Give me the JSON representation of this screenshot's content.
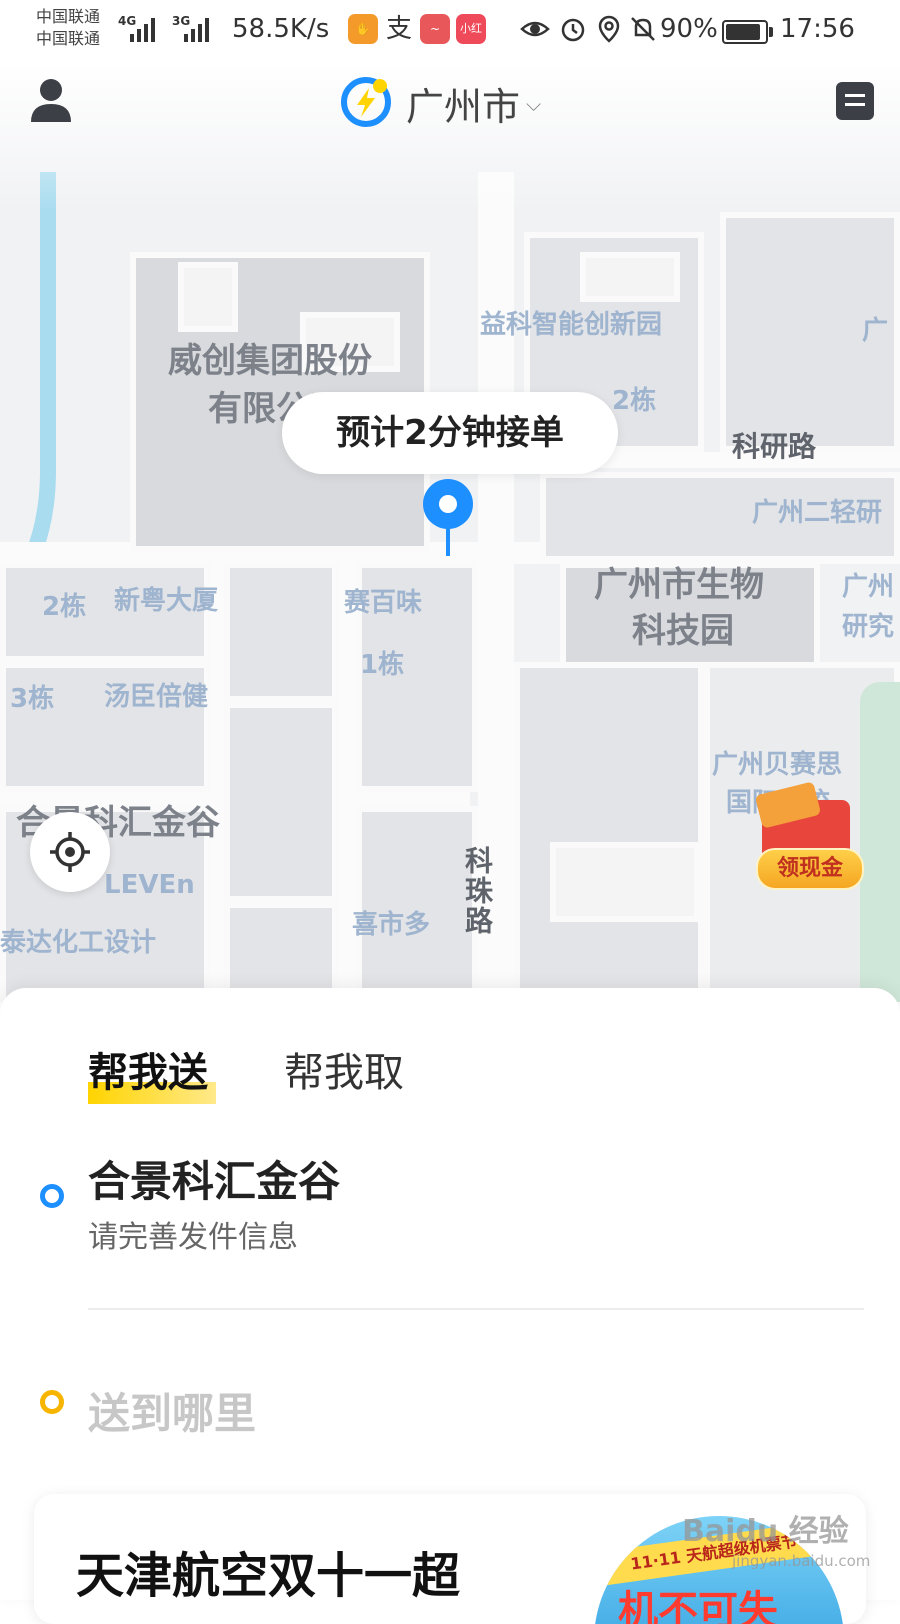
{
  "status_bar": {
    "carrier_1": "中国联通",
    "carrier_2": "中国联通",
    "net_1": "4G",
    "net_2": "3G",
    "speed": "58.5K/s",
    "app_icon_labels": [
      "支",
      "小红书"
    ],
    "battery_percent": "90%",
    "battery_level": 0.9,
    "time": "17:56",
    "icons": [
      "hand-app-icon",
      "alipay-icon",
      "weibo-icon",
      "xiaohongshu-icon",
      "eye-icon",
      "alarm-icon",
      "location-icon",
      "mute-icon",
      "battery-icon"
    ]
  },
  "header": {
    "city": "广州市",
    "icons": [
      "user-icon",
      "flash-logo-icon",
      "chevron-down-icon",
      "menu-icon"
    ]
  },
  "map": {
    "eta": "预计2分钟接单",
    "labels": {
      "weichuang_1": "威创集团股份",
      "weichuang_2": "有限公司",
      "yike": "益科智能创新园",
      "bldg2_right": "2栋",
      "keyan_road": "科研路",
      "gz_light": "广州二轻研",
      "bio_1": "广州市生物",
      "bio_2": "科技园",
      "gz_right_1": "广州",
      "gz_right_2": "研究",
      "bldg2_left": "2栋",
      "xinyue": "新粤大厦",
      "saibaiwei": "赛百味",
      "bldg1": "1栋",
      "bldg3": "3栋",
      "tangchen": "汤臣倍健",
      "beisaisi_1": "广州贝赛思",
      "beisaisi_2": "国际学校",
      "hejing": "合景科汇金谷",
      "eleven": "LEVEn",
      "tailda": "泰达化工设计",
      "xishiduo": "喜市多",
      "kezhu_road": "科珠路",
      "top_right_cut": "广"
    },
    "red_packet_label": "领现金",
    "icons": [
      "location-pin-icon",
      "locate-me-icon",
      "red-packet-icon"
    ]
  },
  "sheet": {
    "tabs": [
      {
        "label": "帮我送",
        "active": true
      },
      {
        "label": "帮我取",
        "active": false
      }
    ],
    "from": {
      "title": "合景科汇金谷",
      "subtitle": "请完善发件信息"
    },
    "to": {
      "placeholder": "送到哪里"
    },
    "promo": {
      "title": "天津航空双十一超",
      "banner": "11·11 天航超级机票节",
      "big_text": "机不可失"
    }
  },
  "watermark": {
    "main": "Baidu 经验",
    "sub": "jingyan.baidu.com"
  },
  "colors": {
    "accent_blue": "#1e8fff",
    "accent_yellow": "#ffd400",
    "pin_blue": "#1e8fff",
    "red_packet": "#e8453c"
  }
}
